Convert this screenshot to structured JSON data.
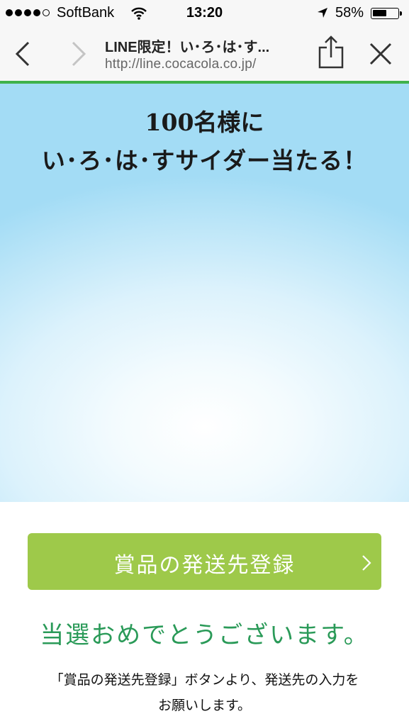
{
  "status_bar": {
    "carrier": "SoftBank",
    "time": "13:20",
    "battery_percent": "58%",
    "battery_level": 0.58
  },
  "browser": {
    "page_title": "LINE限定！い･ろ･は･す...",
    "url": "http://line.cocacola.co.jp/",
    "load_progress": 1.0,
    "progress_color": "#3fb24a"
  },
  "hero": {
    "line1": "100名様に",
    "line2": "い･ろ･は･すサイダー当たる！"
  },
  "cta": {
    "label": "賞品の発送先登録",
    "color": "#9ec94a"
  },
  "message": {
    "congrats": "当選おめでとうございます。",
    "congrats_color": "#2a9a58",
    "note_line1": "「賞品の発送先登録」ボタンより、発送先の入力を",
    "note_line2": "お願いします。"
  }
}
